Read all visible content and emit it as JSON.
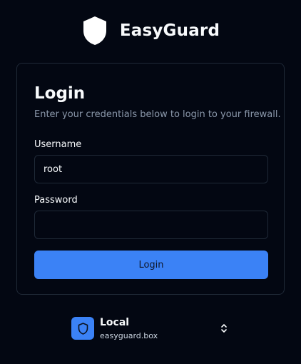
{
  "brand": {
    "name": "EasyGuard",
    "logo_icon": "shield-icon"
  },
  "login_card": {
    "title": "Login",
    "description": "Enter your credentials below to login to your firewall.",
    "username": {
      "label": "Username",
      "value": "root",
      "placeholder": ""
    },
    "password": {
      "label": "Password",
      "value": "",
      "placeholder": ""
    },
    "submit_label": "Login"
  },
  "profile_switcher": {
    "name": "Local",
    "host": "easyguard.box",
    "icon": "shield-icon",
    "toggle_icon": "chevrons-up-down-icon"
  },
  "colors": {
    "background": "#030712",
    "border": "#1f2937",
    "accent": "#3b82f6",
    "muted_text": "#8b98ab"
  }
}
